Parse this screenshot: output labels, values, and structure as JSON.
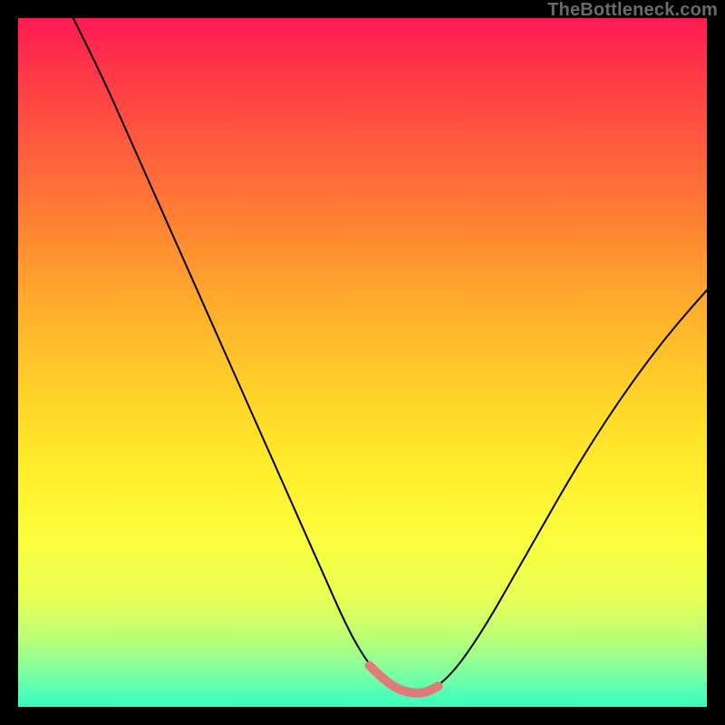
{
  "watermark": "TheBottleneck.com",
  "chart_data": {
    "type": "line",
    "title": "",
    "xlabel": "",
    "ylabel": "",
    "x_range_frac": [
      0.0,
      1.0
    ],
    "y_range_frac": [
      0.0,
      1.0
    ],
    "series": [
      {
        "name": "curve",
        "x_frac": [
          0.08,
          0.12,
          0.16,
          0.2,
          0.24,
          0.28,
          0.32,
          0.36,
          0.4,
          0.44,
          0.48,
          0.51,
          0.54,
          0.57,
          0.59,
          0.61,
          0.64,
          0.68,
          0.72,
          0.76,
          0.8,
          0.84,
          0.88,
          0.92,
          0.96,
          1.0
        ],
        "y_frac": [
          1.0,
          0.92,
          0.83,
          0.74,
          0.65,
          0.56,
          0.47,
          0.38,
          0.29,
          0.2,
          0.11,
          0.06,
          0.03,
          0.02,
          0.02,
          0.03,
          0.06,
          0.12,
          0.19,
          0.26,
          0.33,
          0.395,
          0.455,
          0.51,
          0.56,
          0.605
        ]
      }
    ],
    "highlight_range_x_frac": [
      0.5,
      0.62
    ],
    "gradient_stops": [
      {
        "pos": 0.0,
        "color": "#ff1a53"
      },
      {
        "pos": 0.5,
        "color": "#ffd128"
      },
      {
        "pos": 1.0,
        "color": "#35ffc1"
      }
    ]
  }
}
